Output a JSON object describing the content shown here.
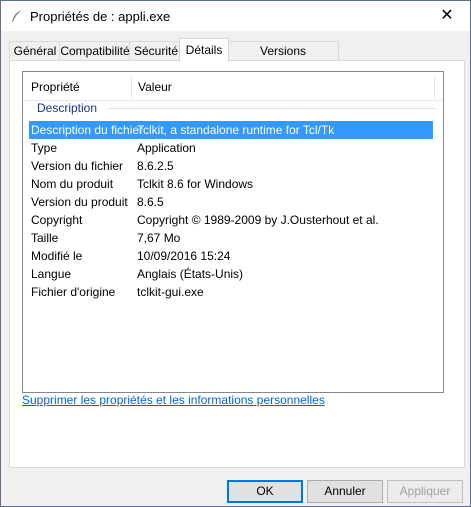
{
  "window": {
    "title": "Propriétés de : appli.exe",
    "close": "✕"
  },
  "tabs": [
    {
      "label": "Général"
    },
    {
      "label": "Compatibilité"
    },
    {
      "label": "Sécurité"
    },
    {
      "label": "Détails"
    },
    {
      "label": "Versions précédentes"
    }
  ],
  "list": {
    "columns": {
      "property": "Propriété",
      "value": "Valeur"
    },
    "group": "Description",
    "rows": [
      {
        "key": "Description du fichier",
        "value": "Tclkit, a standalone runtime for Tcl/Tk",
        "selected": true
      },
      {
        "key": "Type",
        "value": "Application"
      },
      {
        "key": "Version du fichier",
        "value": "8.6.2.5"
      },
      {
        "key": "Nom du produit",
        "value": "Tclkit 8.6 for Windows"
      },
      {
        "key": "Version du produit",
        "value": "8.6.5"
      },
      {
        "key": "Copyright",
        "value": "Copyright © 1989-2009 by J.Ousterhout et al."
      },
      {
        "key": "Taille",
        "value": "7,67 Mo"
      },
      {
        "key": "Modifié le",
        "value": "10/09/2016 15:24"
      },
      {
        "key": "Langue",
        "value": "Anglais (États-Unis)"
      },
      {
        "key": "Fichier d'origine",
        "value": "tclkit-gui.exe"
      }
    ]
  },
  "link": "Supprimer les propriétés et les informations personnelles",
  "buttons": {
    "ok": "OK",
    "cancel": "Annuler",
    "apply": "Appliquer"
  }
}
